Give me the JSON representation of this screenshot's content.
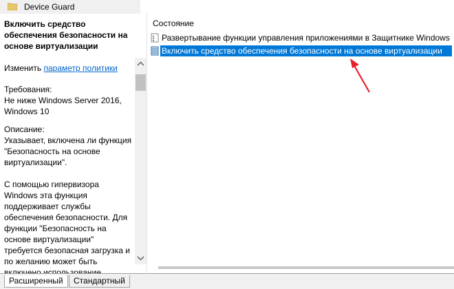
{
  "window": {
    "title": "Device Guard"
  },
  "left_pane": {
    "policy_title": "Включить средство обеспечения безопасности на основе виртуализации",
    "edit_prefix": "Изменить",
    "edit_link": "параметр политики",
    "requirements_label": "Требования:",
    "requirements_value": "Не ниже Windows Server 2016, Windows 10",
    "description_label": "Описание:",
    "description_p1": "Указывает, включена ли функция \"Безопасность на основе виртуализации\".",
    "description_p2": "С помощью гипервизора Windows эта функция поддерживает службы обеспечения безопасности. Для функции \"Безопасность на основе виртуализации\" требуется безопасная загрузка и по желанию может быть включено использование средств защиты с прямым"
  },
  "list": {
    "header": "Состояние",
    "items": [
      {
        "label": "Развертывание функции управления приложениями в Защитнике Windows",
        "icon": "folder-policy-icon",
        "selected": false
      },
      {
        "label": "Включить средство обеспечения безопасности на основе виртуализации",
        "icon": "policy-setting-icon",
        "selected": true
      }
    ]
  },
  "tabs": [
    {
      "label": "Расширенный"
    },
    {
      "label": "Стандартный"
    }
  ],
  "colors": {
    "selection": "#0078d7",
    "annotation_arrow": "#e8202a",
    "link": "#0066cc"
  }
}
